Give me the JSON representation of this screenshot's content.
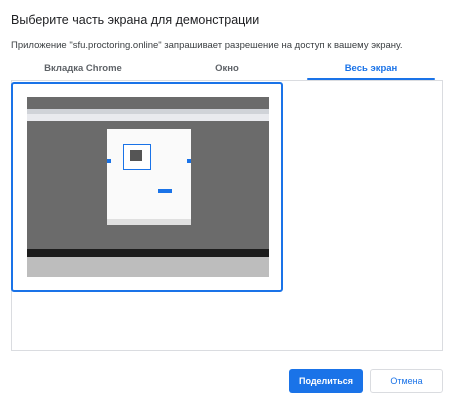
{
  "dialog": {
    "title": "Выберите часть экрана для демонстрации",
    "subtitle": "Приложение \"sfu.proctoring.online\" запрашивает разрешение на доступ к вашему экрану."
  },
  "tabs": [
    {
      "label": "Вкладка Chrome",
      "active": false
    },
    {
      "label": "Окно",
      "active": false
    },
    {
      "label": "Весь экран",
      "active": true
    }
  ],
  "sources": [
    {
      "type": "screen",
      "selected": true
    }
  ],
  "buttons": {
    "share_label": "Поделиться",
    "cancel_label": "Отмена"
  },
  "colors": {
    "accent": "#1a73e8",
    "border": "#dadce0"
  }
}
